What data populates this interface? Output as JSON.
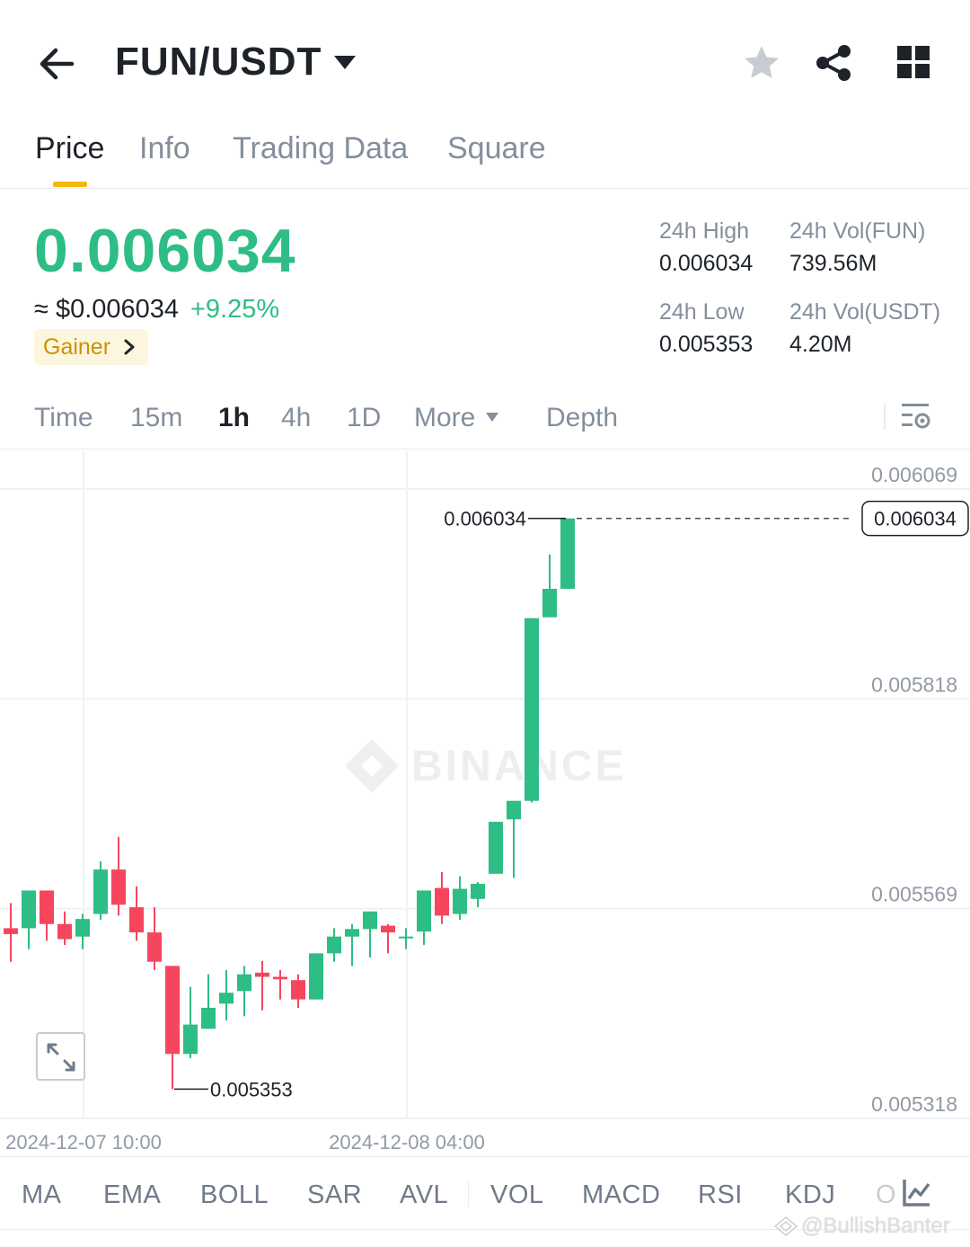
{
  "header": {
    "pair": "FUN/USDT",
    "icons": [
      "back-arrow-icon",
      "caret-down-icon",
      "star-icon",
      "share-icon",
      "grid-icon"
    ]
  },
  "tabs": [
    {
      "label": "Price",
      "active": true
    },
    {
      "label": "Info",
      "active": false
    },
    {
      "label": "Trading Data",
      "active": false
    },
    {
      "label": "Square",
      "active": false
    }
  ],
  "price": {
    "last": "0.006034",
    "fiat": "≈ $0.006034",
    "change": "+9.25%",
    "badge": "Gainer"
  },
  "stats": {
    "high_label": "24h High",
    "high_value": "0.006034",
    "low_label": "24h Low",
    "low_value": "0.005353",
    "vol_base_label": "24h Vol(FUN)",
    "vol_base_value": "739.56M",
    "vol_quote_label": "24h Vol(USDT)",
    "vol_quote_value": "4.20M"
  },
  "intervals": [
    {
      "label": "Time",
      "active": false
    },
    {
      "label": "15m",
      "active": false
    },
    {
      "label": "1h",
      "active": true
    },
    {
      "label": "4h",
      "active": false
    },
    {
      "label": "1D",
      "active": false
    },
    {
      "label": "More",
      "active": false
    },
    {
      "label": "Depth",
      "active": false
    }
  ],
  "chart_data": {
    "type": "candlestick",
    "title": "",
    "y_ticks": [
      "0.006069",
      "0.005818",
      "0.005569",
      "0.005318"
    ],
    "ylim": [
      0.005318,
      0.006069
    ],
    "x_ticks": [
      "2024-12-07 10:00",
      "2024-12-08 04:00"
    ],
    "last_price_label": "0.006034",
    "high_marker": "0.006034",
    "low_marker": "0.005353",
    "watermark": "BINANCE",
    "colors": {
      "up": "#2ebd85",
      "down": "#f6465d",
      "grid": "#f0f1f3",
      "axis_text": "#929aa5"
    },
    "candles": [
      {
        "o": 5.545,
        "h": 5.575,
        "l": 5.505,
        "c": 5.538
      },
      {
        "o": 5.545,
        "h": 5.59,
        "l": 5.52,
        "c": 5.59
      },
      {
        "o": 5.59,
        "h": 5.59,
        "l": 5.53,
        "c": 5.55
      },
      {
        "o": 5.55,
        "h": 5.565,
        "l": 5.525,
        "c": 5.532
      },
      {
        "o": 5.535,
        "h": 5.562,
        "l": 5.52,
        "c": 5.556
      },
      {
        "o": 5.562,
        "h": 5.625,
        "l": 5.555,
        "c": 5.615
      },
      {
        "o": 5.615,
        "h": 5.654,
        "l": 5.56,
        "c": 5.573
      },
      {
        "o": 5.57,
        "h": 5.595,
        "l": 5.53,
        "c": 5.54
      },
      {
        "o": 5.54,
        "h": 5.57,
        "l": 5.495,
        "c": 5.505
      },
      {
        "o": 5.5,
        "h": 5.5,
        "l": 5.353,
        "c": 5.395
      },
      {
        "o": 5.395,
        "h": 5.475,
        "l": 5.39,
        "c": 5.43
      },
      {
        "o": 5.425,
        "h": 5.49,
        "l": 5.43,
        "c": 5.45
      },
      {
        "o": 5.455,
        "h": 5.495,
        "l": 5.435,
        "c": 5.468
      },
      {
        "o": 5.47,
        "h": 5.5,
        "l": 5.44,
        "c": 5.49
      },
      {
        "o": 5.492,
        "h": 5.506,
        "l": 5.447,
        "c": 5.487
      },
      {
        "o": 5.487,
        "h": 5.495,
        "l": 5.46,
        "c": 5.484
      },
      {
        "o": 5.483,
        "h": 5.49,
        "l": 5.45,
        "c": 5.46
      },
      {
        "o": 5.46,
        "h": 5.515,
        "l": 5.46,
        "c": 5.515
      },
      {
        "o": 5.515,
        "h": 5.545,
        "l": 5.505,
        "c": 5.535
      },
      {
        "o": 5.535,
        "h": 5.55,
        "l": 5.5,
        "c": 5.544
      },
      {
        "o": 5.544,
        "h": 5.562,
        "l": 5.51,
        "c": 5.565
      },
      {
        "o": 5.548,
        "h": 5.55,
        "l": 5.515,
        "c": 5.54
      },
      {
        "o": 5.535,
        "h": 5.545,
        "l": 5.52,
        "c": 5.535
      },
      {
        "o": 5.541,
        "h": 5.59,
        "l": 5.525,
        "c": 5.59
      },
      {
        "o": 5.593,
        "h": 5.612,
        "l": 5.55,
        "c": 5.56
      },
      {
        "o": 5.562,
        "h": 5.607,
        "l": 5.555,
        "c": 5.592
      },
      {
        "o": 5.58,
        "h": 5.6,
        "l": 5.57,
        "c": 5.598
      },
      {
        "o": 5.61,
        "h": 5.672,
        "l": 5.61,
        "c": 5.672
      },
      {
        "o": 5.675,
        "h": 5.686,
        "l": 5.605,
        "c": 5.697
      },
      {
        "o": 5.697,
        "h": 5.895,
        "l": 5.695,
        "c": 5.915
      },
      {
        "o": 5.916,
        "h": 5.991,
        "l": 5.918,
        "c": 5.95
      },
      {
        "o": 5.95,
        "h": 6.034,
        "l": 5.95,
        "c": 6.034
      }
    ]
  },
  "expand_icon": "expand-diagonal-icon",
  "indicators": [
    "MA",
    "EMA",
    "BOLL",
    "SAR",
    "AVL",
    "VOL",
    "MACD",
    "RSI",
    "KDJ",
    "O"
  ],
  "watermark_user": "@BullishBanter"
}
